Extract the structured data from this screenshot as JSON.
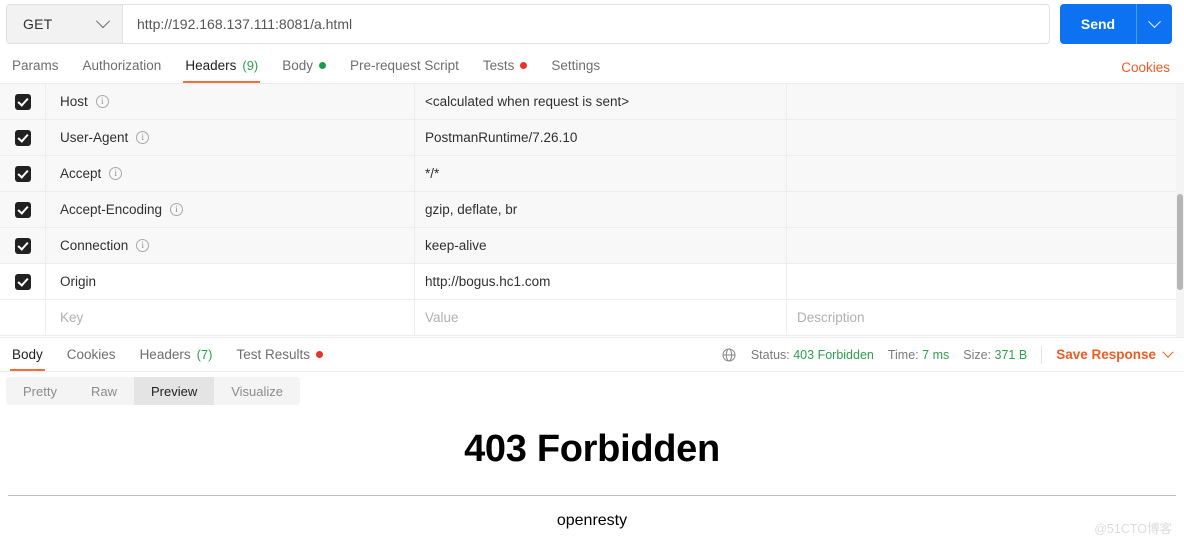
{
  "request": {
    "method": "GET",
    "url": "http://192.168.137.111:8081/a.html",
    "send_label": "Send"
  },
  "request_tabs": [
    {
      "label": "Params",
      "active": false,
      "count": null,
      "dot": null
    },
    {
      "label": "Authorization",
      "active": false,
      "count": null,
      "dot": null
    },
    {
      "label": "Headers",
      "active": true,
      "count": "(9)",
      "dot": null
    },
    {
      "label": "Body",
      "active": false,
      "count": null,
      "dot": "#1b9c4a"
    },
    {
      "label": "Pre-request Script",
      "active": false,
      "count": null,
      "dot": null
    },
    {
      "label": "Tests",
      "active": false,
      "count": null,
      "dot": "#e8322a"
    },
    {
      "label": "Settings",
      "active": false,
      "count": null,
      "dot": null
    }
  ],
  "cookies_link": "Cookies",
  "headers_table": {
    "placeholders": {
      "key": "Key",
      "value": "Value",
      "description": "Description"
    },
    "rows": [
      {
        "checked": true,
        "key": "Host",
        "info": true,
        "value": "<calculated when request is sent>",
        "description": "",
        "auto": true
      },
      {
        "checked": true,
        "key": "User-Agent",
        "info": true,
        "value": "PostmanRuntime/7.26.10",
        "description": "",
        "auto": true
      },
      {
        "checked": true,
        "key": "Accept",
        "info": true,
        "value": "*/*",
        "description": "",
        "auto": true
      },
      {
        "checked": true,
        "key": "Accept-Encoding",
        "info": true,
        "value": "gzip, deflate, br",
        "description": "",
        "auto": true
      },
      {
        "checked": true,
        "key": "Connection",
        "info": true,
        "value": "keep-alive",
        "description": "",
        "auto": true
      },
      {
        "checked": true,
        "key": "Origin",
        "info": false,
        "value": "http://bogus.hc1.com",
        "description": "",
        "auto": false
      }
    ]
  },
  "response_tabs": [
    {
      "label": "Body",
      "active": true,
      "count": null,
      "dot": null
    },
    {
      "label": "Cookies",
      "active": false,
      "count": null,
      "dot": null
    },
    {
      "label": "Headers",
      "active": false,
      "count": "(7)",
      "dot": null
    },
    {
      "label": "Test Results",
      "active": false,
      "count": null,
      "dot": "#e8322a"
    }
  ],
  "response_meta": {
    "status_label": "Status:",
    "status_value": "403 Forbidden",
    "time_label": "Time:",
    "time_value": "7 ms",
    "size_label": "Size:",
    "size_value": "371 B",
    "save_response": "Save Response"
  },
  "view_tabs": [
    {
      "label": "Pretty",
      "active": false
    },
    {
      "label": "Raw",
      "active": false
    },
    {
      "label": "Preview",
      "active": true
    },
    {
      "label": "Visualize",
      "active": false
    }
  ],
  "preview_body": {
    "title": "403 Forbidden",
    "server": "openresty"
  },
  "watermark": "@51CTO博客",
  "colors": {
    "accent_orange": "#ff6c37",
    "link_orange": "#ef5b25",
    "send_blue": "#0c72f2",
    "success_green": "#2e9e4f",
    "error_red": "#e8322a"
  }
}
